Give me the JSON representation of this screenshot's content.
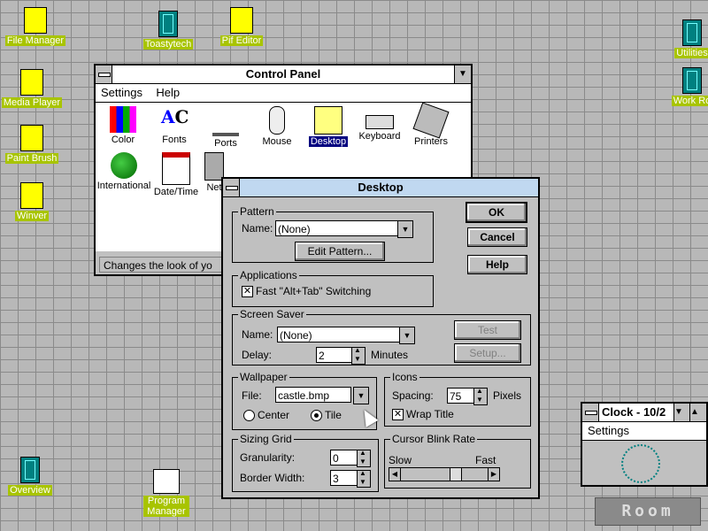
{
  "desktop_icons": [
    {
      "label": "File Manager"
    },
    {
      "label": "Toastytech"
    },
    {
      "label": "Pif Editor"
    },
    {
      "label": "Media Player"
    },
    {
      "label": "Paint Brush"
    },
    {
      "label": "Winver"
    },
    {
      "label": "Overview"
    },
    {
      "label": "Program Manager"
    },
    {
      "label": "Utilities"
    },
    {
      "label": "Work Ro"
    }
  ],
  "control_panel": {
    "title": "Control Panel",
    "menu": [
      "Settings",
      "Help"
    ],
    "icons": [
      "Color",
      "Fonts",
      "Ports",
      "Mouse",
      "Desktop",
      "Keyboard",
      "Printers",
      "International",
      "Date/Time",
      "Net"
    ],
    "status": "Changes the look of yo"
  },
  "desktop_dialog": {
    "title": "Desktop",
    "buttons": {
      "ok": "OK",
      "cancel": "Cancel",
      "help": "Help",
      "test": "Test",
      "setup": "Setup...",
      "edit_pattern": "Edit Pattern..."
    },
    "pattern": {
      "group": "Pattern",
      "name_label": "Name:",
      "value": "(None)"
    },
    "applications": {
      "group": "Applications",
      "fast_switch": "Fast \"Alt+Tab\" Switching",
      "checked": true
    },
    "screen_saver": {
      "group": "Screen Saver",
      "name_label": "Name:",
      "value": "(None)",
      "delay_label": "Delay:",
      "delay": "2",
      "delay_unit": "Minutes"
    },
    "wallpaper": {
      "group": "Wallpaper",
      "file_label": "File:",
      "file": "castle.bmp",
      "center": "Center",
      "tile": "Tile",
      "selected": "tile"
    },
    "icons": {
      "group": "Icons",
      "spacing_label": "Spacing:",
      "spacing": "75",
      "spacing_unit": "Pixels",
      "wrap_title": "Wrap Title",
      "wrap_checked": true
    },
    "sizing_grid": {
      "group": "Sizing Grid",
      "granularity_label": "Granularity:",
      "granularity": "0",
      "border_label": "Border Width:",
      "border": "3"
    },
    "cursor_blink": {
      "group": "Cursor Blink Rate",
      "slow": "Slow",
      "fast": "Fast"
    }
  },
  "clock": {
    "title": "Clock - 10/2",
    "menu": "Settings"
  },
  "room_label": "Room"
}
